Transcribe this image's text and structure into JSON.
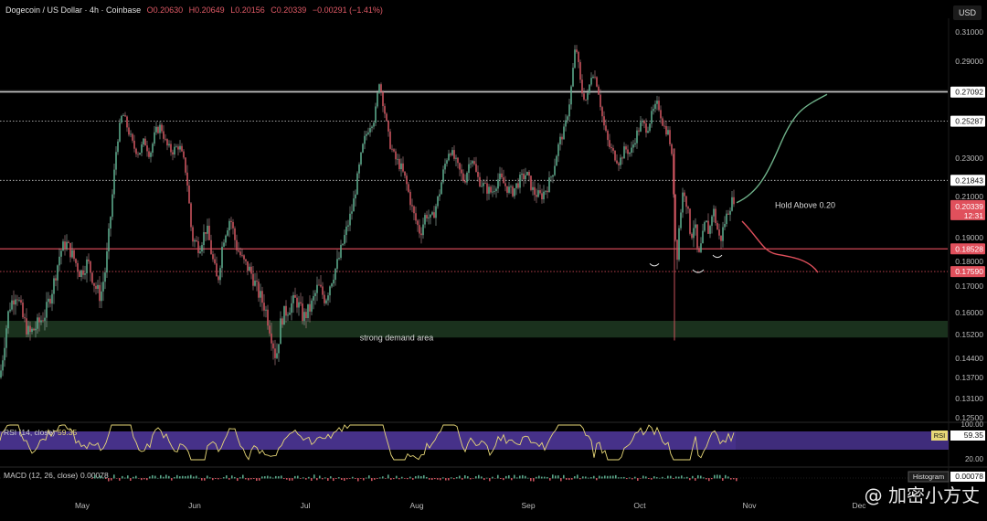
{
  "header": {
    "symbol": "Dogecoin / US Dollar · 4h · Coinbase",
    "open": "O0.20630",
    "high": "H0.20649",
    "low": "L0.20156",
    "close": "C0.20339",
    "change": "−0.00291 (−1.41%)"
  },
  "currency": "USD",
  "watermark": "@ 加密小方丈",
  "chart_data": {
    "type": "candlestick",
    "price_axis": {
      "ticks": [
        "0.31000",
        "0.29000",
        "0.23000",
        "0.21000",
        "0.19000",
        "0.18000",
        "0.17000",
        "0.16000",
        "0.15200",
        "0.14400",
        "0.13700",
        "0.13100",
        "0.12500"
      ],
      "labels_marked": [
        {
          "value": "0.27092",
          "color": "#ffffff"
        },
        {
          "value": "0.25287",
          "color": "#ffffff"
        },
        {
          "value": "0.21843",
          "color": "#ffffff"
        },
        {
          "value": "0.18528",
          "color": "#e0505c"
        },
        {
          "value": "0.17590",
          "color": "#e0505c"
        }
      ],
      "current": {
        "value": "0.20339",
        "timer": "12:31",
        "color": "#e0505c"
      }
    },
    "time_axis": [
      "May",
      "Jun",
      "Jul",
      "Aug",
      "Sep",
      "Oct",
      "Nov",
      "Dec"
    ],
    "levels": [
      {
        "price": 0.27092,
        "style": "solid",
        "color": "#e6e6e6"
      },
      {
        "price": 0.25287,
        "style": "dotted",
        "color": "#d0d0d0"
      },
      {
        "price": 0.21843,
        "style": "dotted",
        "color": "#d0d0d0"
      },
      {
        "price": 0.18528,
        "style": "solid",
        "color": "#d04856"
      },
      {
        "price": 0.1759,
        "style": "dotted",
        "color": "#d04856"
      }
    ],
    "zone": {
      "label": "strong demand area",
      "top": 0.157,
      "bottom": 0.151,
      "color": "#1e3a22"
    },
    "annotation": {
      "text": "Hold Above 0.20"
    },
    "projection_up_color": "#6fb28a",
    "projection_down_color": "#e0505c",
    "path": [
      [
        0,
        0.137
      ],
      [
        5,
        0.15
      ],
      [
        10,
        0.162
      ],
      [
        18,
        0.168
      ],
      [
        25,
        0.158
      ],
      [
        32,
        0.152
      ],
      [
        40,
        0.155
      ],
      [
        50,
        0.16
      ],
      [
        58,
        0.17
      ],
      [
        66,
        0.184
      ],
      [
        72,
        0.188
      ],
      [
        80,
        0.182
      ],
      [
        88,
        0.175
      ],
      [
        96,
        0.18
      ],
      [
        104,
        0.17
      ],
      [
        110,
        0.166
      ],
      [
        116,
        0.178
      ],
      [
        122,
        0.205
      ],
      [
        128,
        0.24
      ],
      [
        134,
        0.258
      ],
      [
        140,
        0.248
      ],
      [
        146,
        0.237
      ],
      [
        152,
        0.233
      ],
      [
        158,
        0.241
      ],
      [
        164,
        0.232
      ],
      [
        170,
        0.246
      ],
      [
        176,
        0.25
      ],
      [
        182,
        0.238
      ],
      [
        188,
        0.234
      ],
      [
        196,
        0.238
      ],
      [
        204,
        0.222
      ],
      [
        210,
        0.19
      ],
      [
        218,
        0.186
      ],
      [
        226,
        0.195
      ],
      [
        232,
        0.182
      ],
      [
        238,
        0.171
      ],
      [
        244,
        0.189
      ],
      [
        252,
        0.2
      ],
      [
        258,
        0.187
      ],
      [
        266,
        0.18
      ],
      [
        274,
        0.176
      ],
      [
        282,
        0.168
      ],
      [
        290,
        0.162
      ],
      [
        297,
        0.152
      ],
      [
        302,
        0.144
      ],
      [
        308,
        0.158
      ],
      [
        316,
        0.162
      ],
      [
        324,
        0.165
      ],
      [
        332,
        0.158
      ],
      [
        340,
        0.162
      ],
      [
        348,
        0.17
      ],
      [
        356,
        0.165
      ],
      [
        362,
        0.172
      ],
      [
        370,
        0.18
      ],
      [
        378,
        0.192
      ],
      [
        386,
        0.205
      ],
      [
        392,
        0.222
      ],
      [
        398,
        0.24
      ],
      [
        404,
        0.25
      ],
      [
        410,
        0.255
      ],
      [
        415,
        0.278
      ],
      [
        420,
        0.262
      ],
      [
        426,
        0.24
      ],
      [
        432,
        0.23
      ],
      [
        438,
        0.226
      ],
      [
        444,
        0.218
      ],
      [
        452,
        0.202
      ],
      [
        460,
        0.192
      ],
      [
        466,
        0.202
      ],
      [
        472,
        0.198
      ],
      [
        480,
        0.21
      ],
      [
        486,
        0.225
      ],
      [
        492,
        0.236
      ],
      [
        500,
        0.226
      ],
      [
        508,
        0.218
      ],
      [
        516,
        0.232
      ],
      [
        522,
        0.22
      ],
      [
        530,
        0.215
      ],
      [
        538,
        0.212
      ],
      [
        546,
        0.22
      ],
      [
        554,
        0.215
      ],
      [
        560,
        0.212
      ],
      [
        568,
        0.218
      ],
      [
        576,
        0.222
      ],
      [
        584,
        0.212
      ],
      [
        592,
        0.21
      ],
      [
        600,
        0.216
      ],
      [
        606,
        0.225
      ],
      [
        612,
        0.24
      ],
      [
        618,
        0.248
      ],
      [
        624,
        0.268
      ],
      [
        630,
        0.302
      ],
      [
        636,
        0.272
      ],
      [
        642,
        0.265
      ],
      [
        648,
        0.285
      ],
      [
        654,
        0.275
      ],
      [
        660,
        0.252
      ],
      [
        666,
        0.238
      ],
      [
        672,
        0.232
      ],
      [
        678,
        0.228
      ],
      [
        684,
        0.236
      ],
      [
        690,
        0.233
      ],
      [
        696,
        0.244
      ],
      [
        702,
        0.252
      ],
      [
        708,
        0.248
      ],
      [
        714,
        0.258
      ],
      [
        720,
        0.264
      ],
      [
        726,
        0.25
      ],
      [
        732,
        0.245
      ],
      [
        736,
        0.225
      ],
      [
        740,
        0.178
      ],
      [
        744,
        0.2
      ],
      [
        748,
        0.215
      ],
      [
        752,
        0.205
      ],
      [
        756,
        0.19
      ],
      [
        760,
        0.198
      ],
      [
        764,
        0.18
      ],
      [
        768,
        0.188
      ],
      [
        772,
        0.198
      ],
      [
        776,
        0.192
      ],
      [
        780,
        0.205
      ],
      [
        784,
        0.196
      ],
      [
        788,
        0.188
      ],
      [
        792,
        0.196
      ],
      [
        798,
        0.205
      ],
      [
        804,
        0.21
      ]
    ]
  },
  "rsi": {
    "label": "RSI (14, close)",
    "value": "59.35",
    "legend": "RSI",
    "ticks": [
      "100.00",
      "20.00"
    ],
    "band_color": "#4a3490",
    "line_color": "#e8d878"
  },
  "macd": {
    "label": "MACD (12, 26, close)",
    "value": "0.00078",
    "legend": "Histogram",
    "hist_value": "0.00078"
  }
}
